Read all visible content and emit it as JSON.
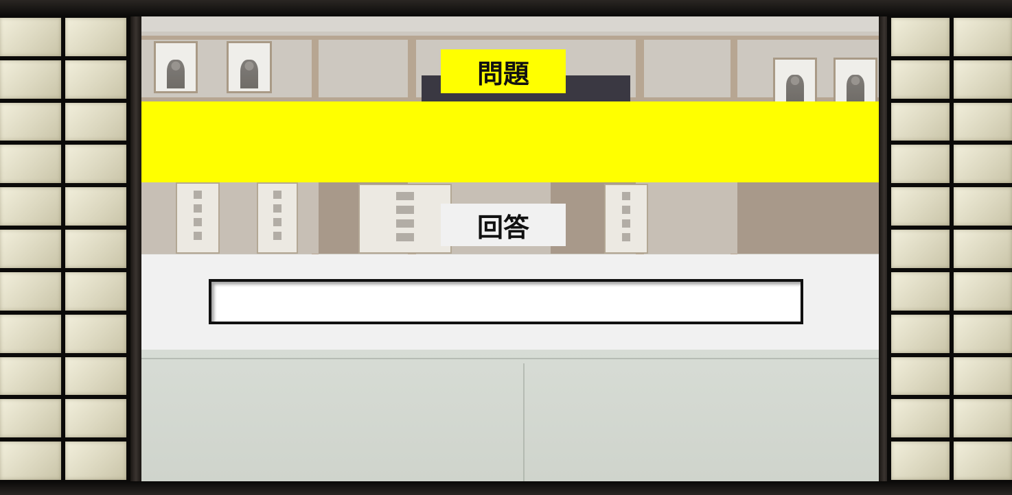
{
  "question": {
    "label": "問題",
    "text": ""
  },
  "answer": {
    "label": "回答",
    "value": "",
    "placeholder": ""
  },
  "colors": {
    "question_highlight": "#ffff00",
    "answer_panel": "#f1f1f1",
    "frame": "#0d0b0a",
    "shoji_paper": "#e6e2cc"
  }
}
